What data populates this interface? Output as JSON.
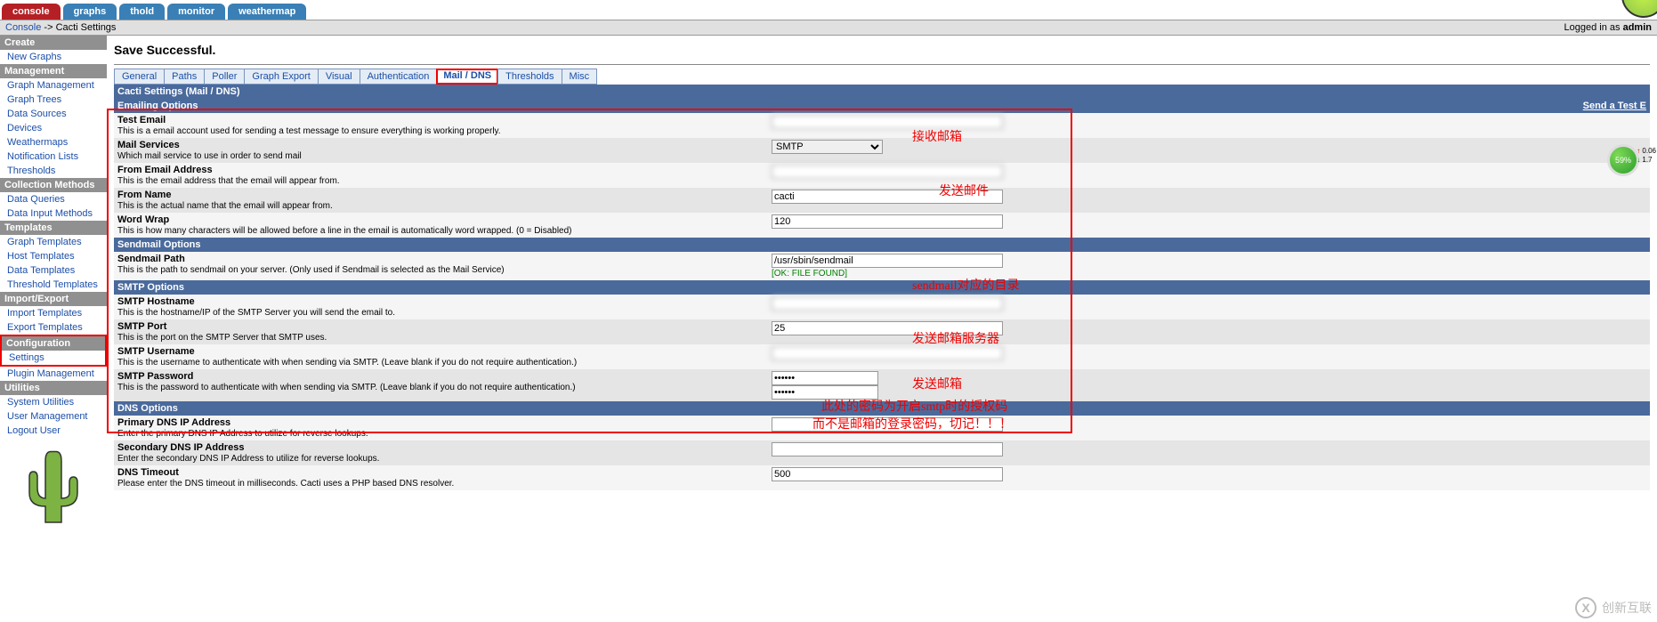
{
  "top_tabs": {
    "console": "console",
    "graphs": "graphs",
    "thold": "thold",
    "monitor": "monitor",
    "weathermap": "weathermap"
  },
  "breadcrumb": {
    "console": "Console",
    "sep": " -> ",
    "page": "Cacti Settings"
  },
  "login": {
    "prefix": "Logged in as ",
    "user": "admin"
  },
  "sidebar": {
    "create": "Create",
    "new_graphs": "New Graphs",
    "management": "Management",
    "graph_management": "Graph Management",
    "graph_trees": "Graph Trees",
    "data_sources": "Data Sources",
    "devices": "Devices",
    "weathermaps": "Weathermaps",
    "notification_lists": "Notification Lists",
    "thresholds": "Thresholds",
    "collection_methods": "Collection Methods",
    "data_queries": "Data Queries",
    "data_input_methods": "Data Input Methods",
    "templates": "Templates",
    "graph_templates": "Graph Templates",
    "host_templates": "Host Templates",
    "data_templates": "Data Templates",
    "threshold_templates": "Threshold Templates",
    "import_export": "Import/Export",
    "import_templates": "Import Templates",
    "export_templates": "Export Templates",
    "configuration": "Configuration",
    "settings": "Settings",
    "plugin_management": "Plugin Management",
    "utilities": "Utilities",
    "system_utilities": "System Utilities",
    "user_management": "User Management",
    "logout_user": "Logout User"
  },
  "save_msg": "Save Successful.",
  "tabs": {
    "general": "General",
    "paths": "Paths",
    "poller": "Poller",
    "graph_export": "Graph Export",
    "visual": "Visual",
    "authentication": "Authentication",
    "mail_dns": "Mail / DNS",
    "thresholds": "Thresholds",
    "misc": "Misc"
  },
  "headers": {
    "title": "Cacti Settings (Mail / DNS)",
    "emailing": "Emailing Options",
    "send_test": "Send a Test E",
    "sendmail": "Sendmail Options",
    "smtp": "SMTP Options",
    "dns": "DNS Options"
  },
  "fields": {
    "test_email": {
      "label": "Test Email",
      "desc": "This is a email account used for sending a test message to ensure everything is working properly.",
      "value": ""
    },
    "mail_services": {
      "label": "Mail Services",
      "desc": "Which mail service to use in order to send mail",
      "value": "SMTP"
    },
    "from_email": {
      "label": "From Email Address",
      "desc": "This is the email address that the email will appear from.",
      "value": ""
    },
    "from_name": {
      "label": "From Name",
      "desc": "This is the actual name that the email will appear from.",
      "value": "cacti"
    },
    "word_wrap": {
      "label": "Word Wrap",
      "desc": "This is how many characters will be allowed before a line in the email is automatically word wrapped. (0 = Disabled)",
      "value": "120"
    },
    "sendmail_path": {
      "label": "Sendmail Path",
      "desc": "This is the path to sendmail on your server. (Only used if Sendmail is selected as the Mail Service)",
      "value": "/usr/sbin/sendmail",
      "ok": "[OK: FILE FOUND]"
    },
    "smtp_hostname": {
      "label": "SMTP Hostname",
      "desc": "This is the hostname/IP of the SMTP Server you will send the email to.",
      "value": ""
    },
    "smtp_port": {
      "label": "SMTP Port",
      "desc": "This is the port on the SMTP Server that SMTP uses.",
      "value": "25"
    },
    "smtp_username": {
      "label": "SMTP Username",
      "desc": "This is the username to authenticate with when sending via SMTP. (Leave blank if you do not require authentication.)",
      "value": ""
    },
    "smtp_password": {
      "label": "SMTP Password",
      "desc": "This is the password to authenticate with when sending via SMTP. (Leave blank if you do not require authentication.)",
      "value": "••••••"
    },
    "dns_primary": {
      "label": "Primary DNS IP Address",
      "desc": "Enter the primary DNS IP Address to utilize for reverse lookups.",
      "value": ""
    },
    "dns_secondary": {
      "label": "Secondary DNS IP Address",
      "desc": "Enter the secondary DNS IP Address to utilize for reverse lookups.",
      "value": ""
    },
    "dns_timeout": {
      "label": "DNS Timeout",
      "desc": "Please enter the DNS timeout in milliseconds. Cacti uses a PHP based DNS resolver.",
      "value": "500"
    }
  },
  "annotations": {
    "test_email": "接收邮箱",
    "from_email": "发送邮件",
    "sendmail": "sendmail对应的目录",
    "smtp_host": "发送邮箱服务器",
    "smtp_user": "发送邮箱",
    "smtp_pass1": "此处的密码为开启smtp时的授权码",
    "smtp_pass2": "而不是邮箱的登录密码，切记！！！"
  },
  "gauge": {
    "pct": "59%",
    "up": "0.06",
    "down": "1.7"
  },
  "watermark": "创新互联"
}
